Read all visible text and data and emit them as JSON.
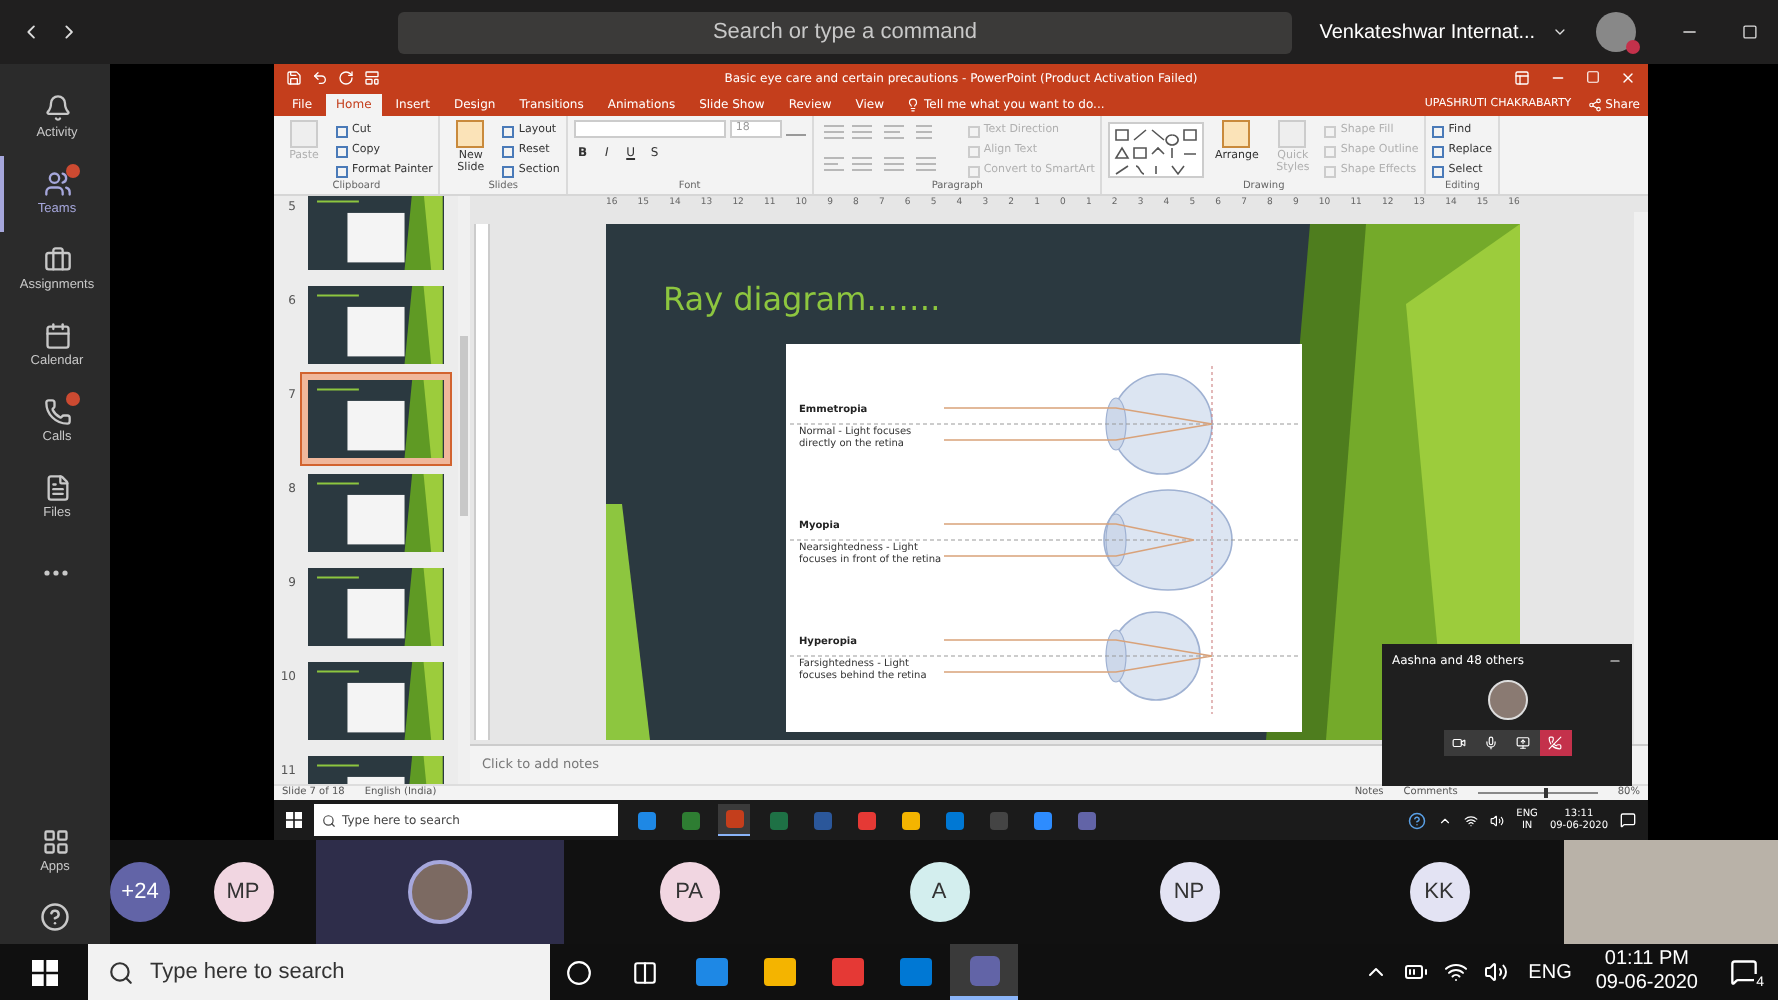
{
  "top_bar": {
    "search_placeholder": "Search or type a command",
    "org": "Venkateshwar Internat..."
  },
  "rail": {
    "items": [
      {
        "kind": "nav",
        "label": "Activity",
        "selected": false,
        "alert": false
      },
      {
        "kind": "nav",
        "label": "Teams",
        "selected": true,
        "alert": true
      },
      {
        "kind": "nav",
        "label": "Assignments",
        "selected": false,
        "alert": false
      },
      {
        "kind": "nav",
        "label": "Calendar",
        "selected": false,
        "alert": false
      },
      {
        "kind": "nav",
        "label": "Calls",
        "selected": false,
        "alert": true
      },
      {
        "kind": "nav",
        "label": "Files",
        "selected": false,
        "alert": false
      },
      {
        "kind": "more",
        "selected": false
      }
    ],
    "apps_label": "Apps"
  },
  "powerpoint": {
    "title": "Basic eye care and certain precautions - PowerPoint (Product Activation Failed)",
    "tabs": [
      {
        "label": "File",
        "selected": false
      },
      {
        "label": "Home",
        "selected": true
      },
      {
        "label": "Insert",
        "selected": false
      },
      {
        "label": "Design",
        "selected": false
      },
      {
        "label": "Transitions",
        "selected": false
      },
      {
        "label": "Animations",
        "selected": false
      },
      {
        "label": "Slide Show",
        "selected": false
      },
      {
        "label": "Review",
        "selected": false
      },
      {
        "label": "View",
        "selected": false
      }
    ],
    "tell_me": "Tell me what you want to do...",
    "user": "UPASHRUTI CHAKRABARTY",
    "share": "Share",
    "ribbon": [
      {
        "kind": "plain",
        "label": "Clipboard",
        "items": [
          {
            "kind": "large",
            "label": "Paste",
            "disabled": true
          },
          {
            "kind": "small",
            "label": "Cut",
            "disabled": false
          },
          {
            "kind": "small",
            "label": "Copy",
            "disabled": false
          },
          {
            "kind": "small",
            "label": "Format Painter",
            "disabled": false
          }
        ]
      },
      {
        "kind": "plain",
        "label": "Slides",
        "items": [
          {
            "kind": "large",
            "label": "New Slide",
            "disabled": false
          },
          {
            "kind": "small",
            "label": "Layout",
            "disabled": false
          },
          {
            "kind": "small",
            "label": "Reset",
            "disabled": false
          },
          {
            "kind": "small",
            "label": "Section",
            "disabled": false
          }
        ]
      },
      {
        "kind": "font",
        "label": "Font",
        "size": "18",
        "items": [
          {
            "kind": "letter",
            "label": "B",
            "disabled": false
          },
          {
            "kind": "letter",
            "label": "I",
            "disabled": false
          },
          {
            "kind": "letter",
            "label": "U",
            "disabled": false
          },
          {
            "kind": "letter",
            "label": "S",
            "disabled": false
          }
        ]
      },
      {
        "kind": "paragraph",
        "label": "Paragraph",
        "items": [
          {
            "kind": "small",
            "label": "Text Direction",
            "disabled": true
          },
          {
            "kind": "small",
            "label": "Align Text",
            "disabled": true
          },
          {
            "kind": "small",
            "label": "Convert to SmartArt",
            "disabled": true
          }
        ]
      },
      {
        "kind": "drawing",
        "label": "Drawing",
        "items": [
          {
            "kind": "large",
            "label": "Arrange",
            "disabled": false
          },
          {
            "kind": "large",
            "label": "Quick Styles",
            "disabled": true
          },
          {
            "kind": "small",
            "label": "Shape Fill",
            "disabled": true
          },
          {
            "kind": "small",
            "label": "Shape Outline",
            "disabled": true
          },
          {
            "kind": "small",
            "label": "Shape Effects",
            "disabled": true
          }
        ]
      },
      {
        "kind": "plain",
        "label": "Editing",
        "items": [
          {
            "kind": "small",
            "label": "Find",
            "disabled": false
          },
          {
            "kind": "small",
            "label": "Replace",
            "disabled": false
          },
          {
            "kind": "small",
            "label": "Select",
            "disabled": false
          }
        ]
      }
    ],
    "ruler": [
      "16",
      "15",
      "14",
      "13",
      "12",
      "11",
      "10",
      "9",
      "8",
      "7",
      "6",
      "5",
      "4",
      "3",
      "2",
      "1",
      "0",
      "1",
      "2",
      "3",
      "4",
      "5",
      "6",
      "7",
      "8",
      "9",
      "10",
      "11",
      "12",
      "13",
      "14",
      "15",
      "16"
    ],
    "slides": [
      {
        "number": "5",
        "selected": false
      },
      {
        "number": "6",
        "selected": false
      },
      {
        "number": "7",
        "selected": true
      },
      {
        "number": "8",
        "selected": false
      },
      {
        "number": "9",
        "selected": false
      },
      {
        "number": "10",
        "selected": false
      },
      {
        "number": "11",
        "selected": false
      }
    ],
    "slide": {
      "title": "Ray diagram…….",
      "rows": [
        {
          "kind": "on",
          "term": "Emmetropia",
          "desc": "Normal - Light focuses directly on the retina"
        },
        {
          "kind": "front",
          "term": "Myopia",
          "desc": "Nearsightedness - Light focuses in front of the retina"
        },
        {
          "kind": "behind",
          "term": "Hyperopia",
          "desc": "Farsightedness - Light focuses behind the retina"
        }
      ]
    },
    "notes_placeholder": "Click to add notes",
    "status": {
      "slide": "Slide 7 of 18",
      "language": "English (India)",
      "notes": "Notes",
      "comments": "Comments",
      "zoom": "80%",
      "level": 0.55
    }
  },
  "call": {
    "title": "Aashna and 48 others"
  },
  "inner_taskbar": {
    "search": "Type here to search",
    "lang": "ENG",
    "region": "IN",
    "time": "13:11",
    "date": "09-06-2020"
  },
  "participants": [
    {
      "kind": "initials",
      "label": "+24",
      "color": "#6264a7",
      "selected": false
    },
    {
      "kind": "initials",
      "label": "MP",
      "color": "#f1d6e1",
      "selected": false
    },
    {
      "kind": "photo",
      "selected": true
    },
    {
      "kind": "initials",
      "label": "PA",
      "color": "#f1d6e1",
      "selected": false
    },
    {
      "kind": "initials",
      "label": "A",
      "color": "#d3eeee",
      "selected": false
    },
    {
      "kind": "initials",
      "label": "NP",
      "color": "#e3e3f3",
      "selected": false
    },
    {
      "kind": "initials",
      "label": "KK",
      "color": "#e3e3f3",
      "selected": false
    }
  ],
  "taskbar": {
    "search": "Type here to search",
    "lang": "ENG",
    "time": "01:11 PM",
    "date": "09-06-2020",
    "notifications": "4"
  }
}
